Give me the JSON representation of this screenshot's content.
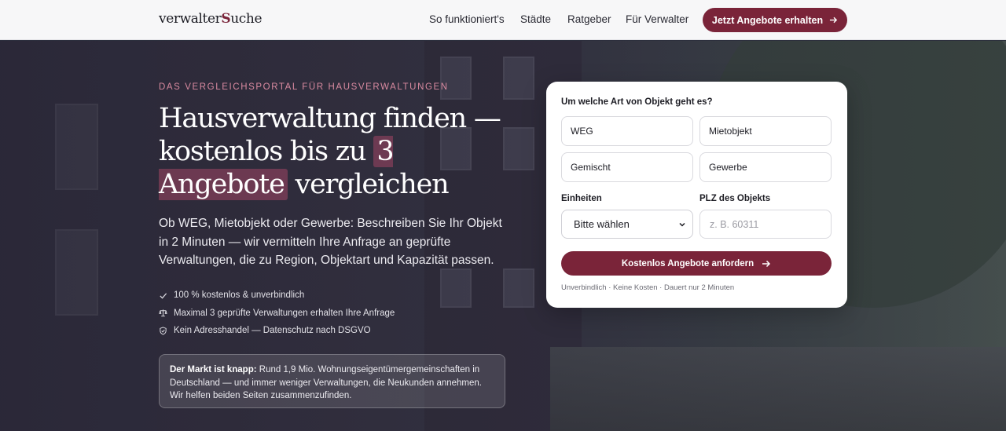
{
  "nav": {
    "logo_main": "verwalter",
    "logo_accent": "S",
    "logo_rest": "uche",
    "links": [
      "So funktioniert's",
      "Städte",
      "Ratgeber",
      "Für Verwalter"
    ],
    "cta_label": "Jetzt Angebote erhalten",
    "cta_icon": "arrow-right-icon"
  },
  "hero": {
    "eyebrow": "DAS VERGLEICHSPORTAL FÜR HAUSVERWALTUNGEN",
    "headline_part1": "Hausverwaltung finden — kostenlos bis zu",
    "headline_highlight": "3 Angebote",
    "headline_part2": "vergleichen",
    "lead": "Ob WEG, Mietobjekt oder Gewerbe: Beschreiben Sie Ihr Objekt in 2 Minuten — wir vermitteln Ihre Anfrage an geprüfte Verwaltungen, die zu Region, Objektart und Kapazität passen.",
    "checks": [
      {
        "icon": "check-icon",
        "text": "100 % kostenlos & unverbindlich"
      },
      {
        "icon": "scale-icon",
        "text": "Maximal 3 geprüfte Verwaltungen erhalten Ihre Anfrage"
      },
      {
        "icon": "shield-icon",
        "text": "Kein Adresshandel — Datenschutz nach DSGVO"
      }
    ],
    "note_bold": "Der Markt ist knapp:",
    "note_text": " Rund 1,9 Mio. Wohnungseigentümergemeinschaften in Deutschland — und immer weniger Verwaltungen, die Neukunden annehmen. Wir helfen beiden Seiten zusammenzufinden."
  },
  "form": {
    "question": "Um welche Art von Objekt geht es?",
    "options": [
      "WEG",
      "Mietobjekt",
      "Gemischt",
      "Gewerbe"
    ],
    "units_label": "Einheiten",
    "units_value": "Bitte wählen",
    "plz_label": "PLZ des Objekts",
    "plz_placeholder": "z. B. 60311",
    "submit_label": "Kostenlos Angebote anfordern",
    "fine_print": "Unverbindlich · Keine Kosten · Dauert nur 2 Minuten"
  },
  "colors": {
    "brand": "#7a2439",
    "eyebrow": "#d98aa0"
  }
}
